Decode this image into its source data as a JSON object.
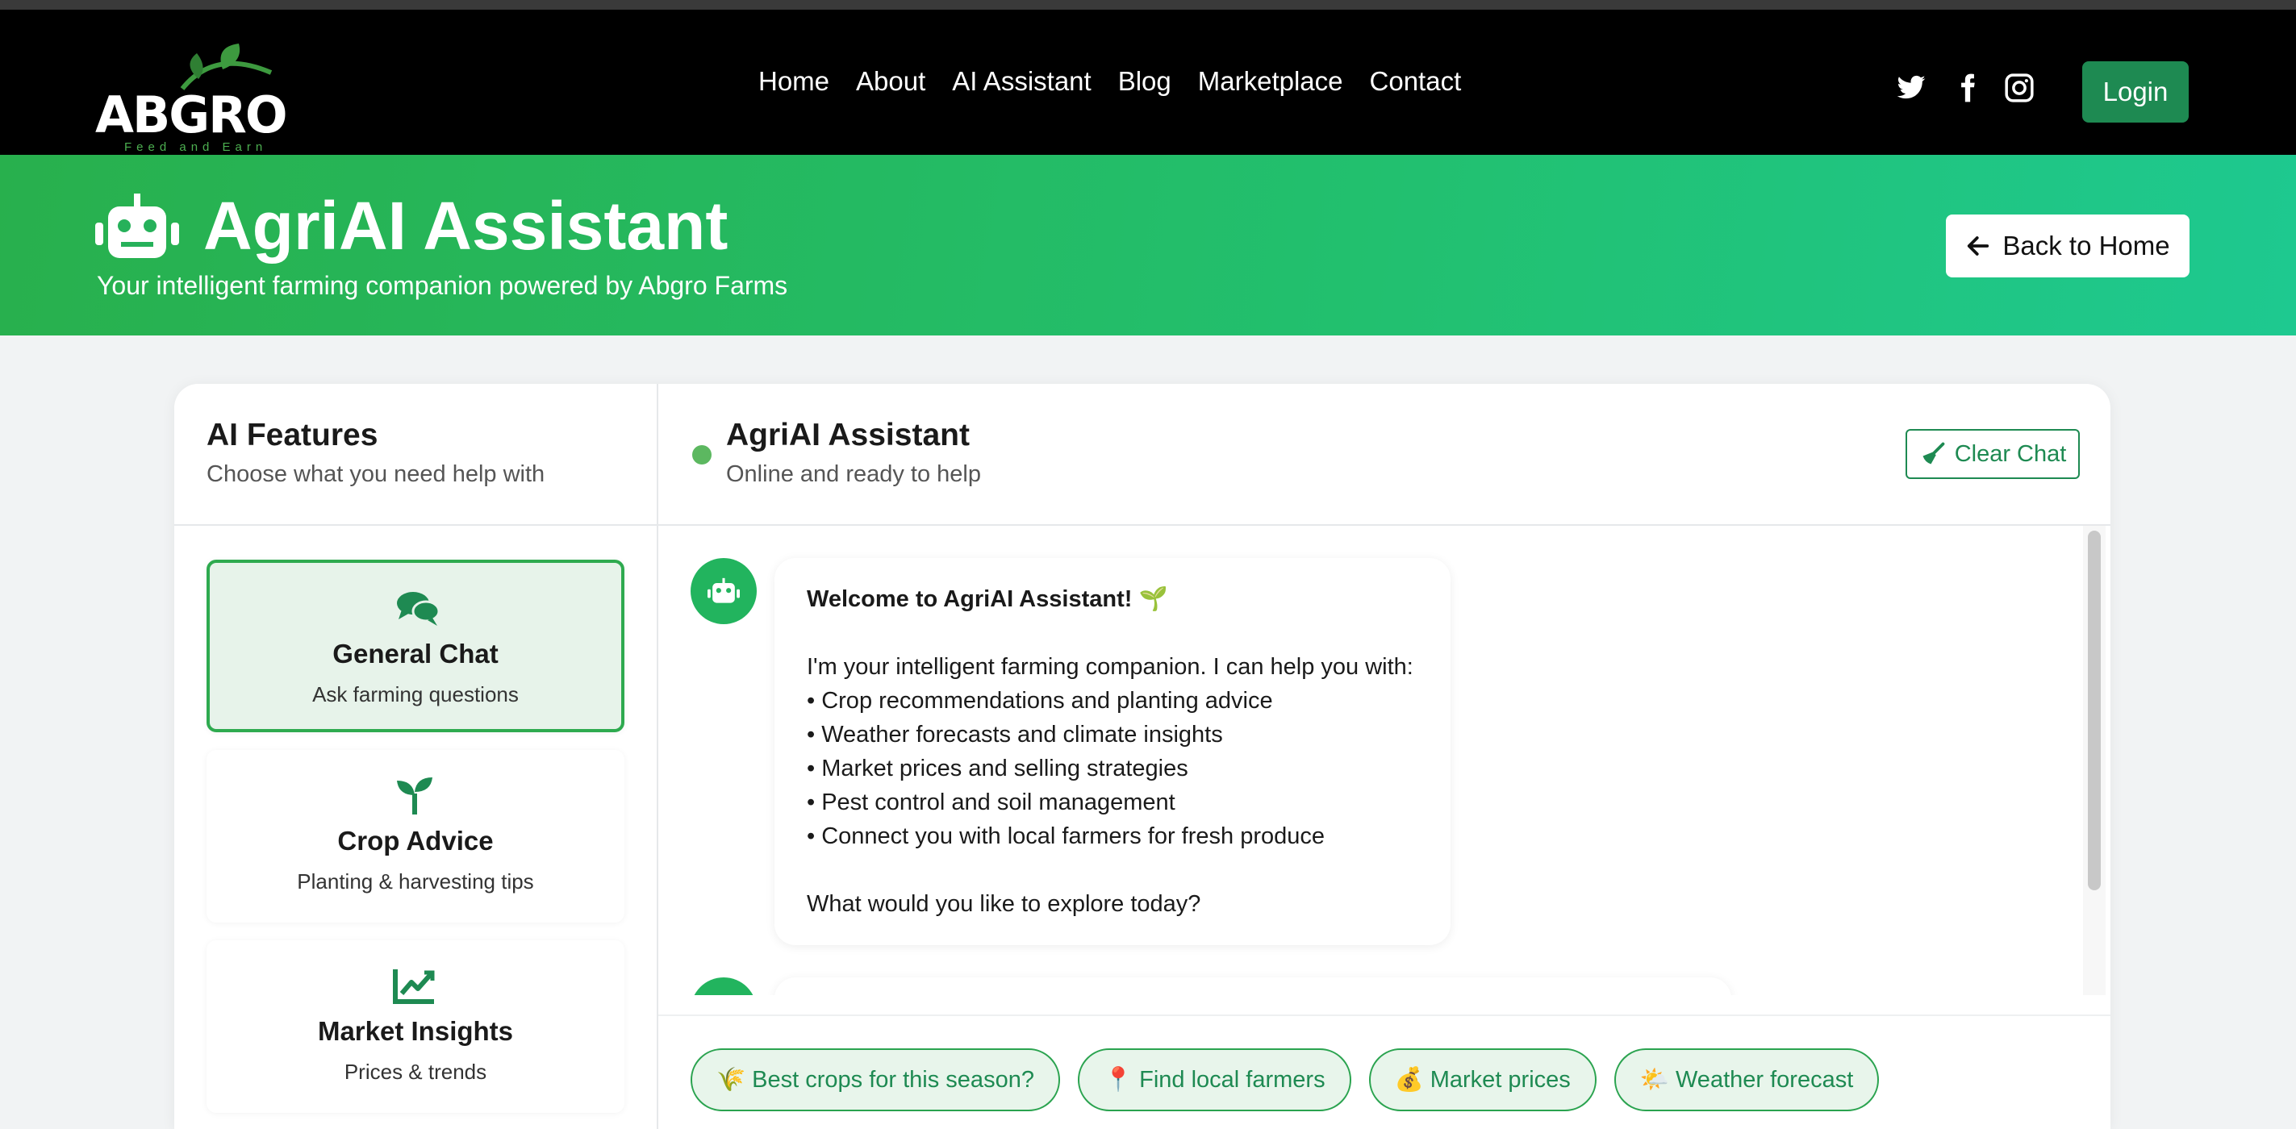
{
  "brand": {
    "name": "ABGRO",
    "tagline": "Feed and Earn"
  },
  "nav": {
    "links": [
      "Home",
      "About",
      "AI Assistant",
      "Blog",
      "Marketplace",
      "Contact"
    ],
    "social_icons": [
      "twitter-icon",
      "facebook-icon",
      "instagram-icon"
    ],
    "login_label": "Login"
  },
  "hero": {
    "title": "AgriAI Assistant",
    "subtitle": "Your intelligent farming companion powered by Abgro Farms",
    "back_label": "Back to Home"
  },
  "sidebar": {
    "title": "AI Features",
    "subtitle": "Choose what you need help with",
    "features": [
      {
        "title": "General Chat",
        "desc": "Ask farming questions",
        "icon": "chat-bubbles-icon",
        "active": true
      },
      {
        "title": "Crop Advice",
        "desc": "Planting & harvesting tips",
        "icon": "seedling-icon",
        "active": false
      },
      {
        "title": "Market Insights",
        "desc": "Prices & trends",
        "icon": "chart-line-icon",
        "active": false
      }
    ]
  },
  "chat": {
    "title": "AgriAI Assistant",
    "status": "Online and ready to help",
    "clear_label": "Clear Chat",
    "messages": [
      {
        "from": "bot",
        "lines": [
          "Welcome to AgriAI Assistant! 🌱",
          "",
          "I'm your intelligent farming companion. I can help you with:",
          "• Crop recommendations and planting advice",
          "• Weather forecasts and climate insights",
          "• Market prices and selling strategies",
          "• Pest control and soil management",
          "• Connect you with local farmers for fresh produce",
          "",
          "What would you like to explore today?"
        ]
      }
    ]
  },
  "quick_actions": [
    "🌾 Best crops for this season?",
    "📍 Find local farmers",
    "💰 Market prices",
    "🌤️ Weather forecast"
  ],
  "colors": {
    "brand_green": "#1e8a52",
    "hero_start": "#28b04d",
    "hero_end": "#1ec990",
    "active_bg": "#e7f3ea"
  }
}
